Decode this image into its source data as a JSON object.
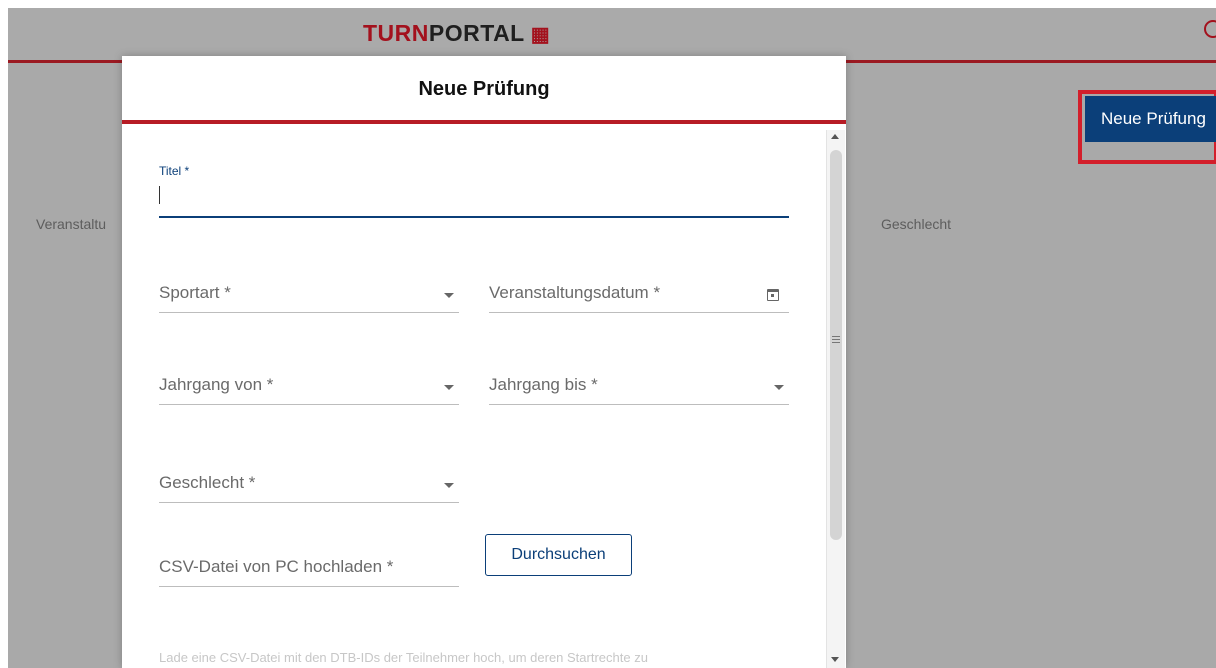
{
  "header": {
    "logo_turn": "TURN",
    "logo_portal": "PORTAL",
    "logo_mark": "⁑"
  },
  "background": {
    "new_exam_button": "Neue Prüfung",
    "column_event": "Veranstaltu",
    "column_gender": "Geschlecht"
  },
  "modal": {
    "title": "Neue Prüfung",
    "fields": {
      "titel_label": "Titel *",
      "titel_value": "",
      "sportart": "Sportart *",
      "veranstaltungsdatum": "Veranstaltungsdatum *",
      "jahrgang_von": "Jahrgang von *",
      "jahrgang_bis": "Jahrgang bis *",
      "geschlecht": "Geschlecht *",
      "csv": "CSV-Datei von PC hochladen *"
    },
    "browse_button": "Durchsuchen",
    "help_text": "Lade eine CSV-Datei mit den DTB-IDs der Teilnehmer hoch, um deren Startrechte zu"
  },
  "colors": {
    "brand_red": "#a3111d",
    "primary_blue": "#0b3f79",
    "highlight_red": "#d31f2b"
  },
  "icons": [
    "dropdown-arrow-icon",
    "calendar-icon",
    "scroll-up-icon",
    "scroll-down-icon"
  ]
}
